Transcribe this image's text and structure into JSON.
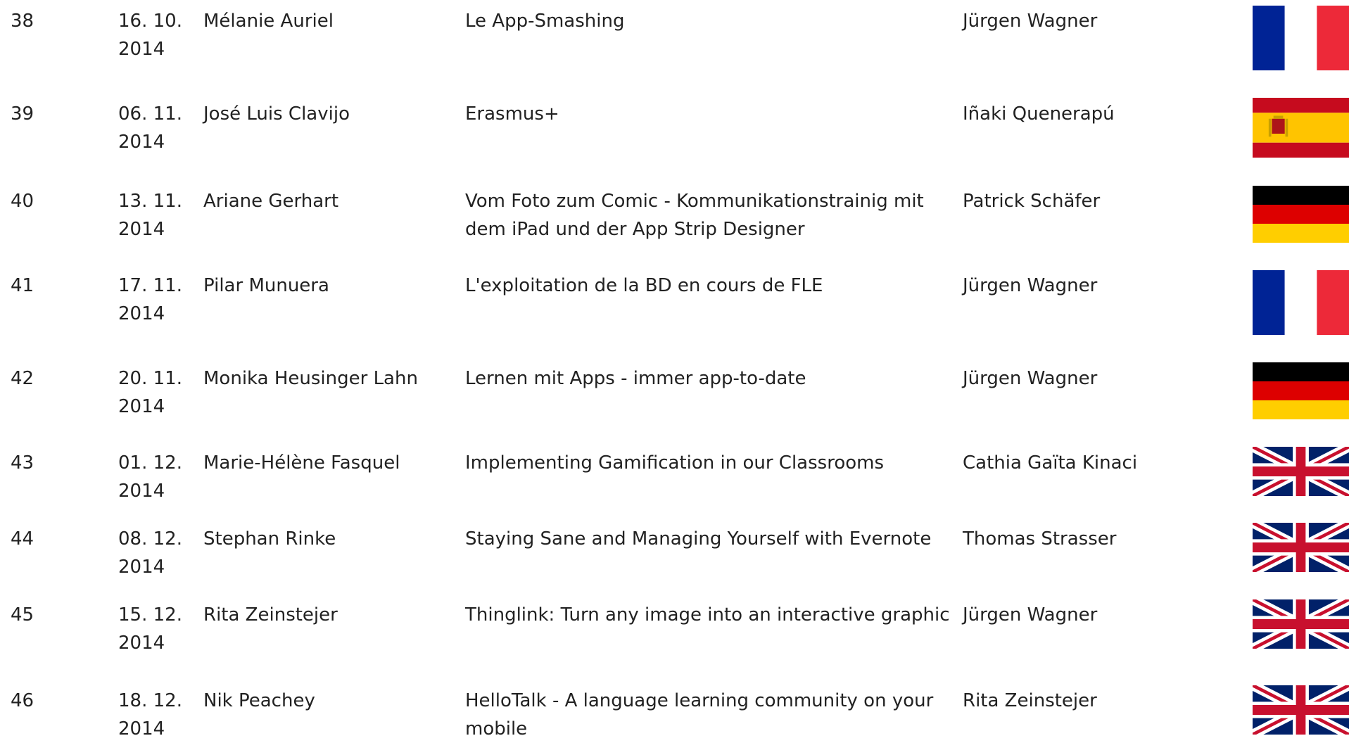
{
  "table": {
    "rows": [
      {
        "num": "38",
        "date_line1": "16. 10.",
        "date_line2": "2014",
        "speaker": "Mélanie Auriel",
        "topic": "Le App-Smashing",
        "host": "Jürgen Wagner",
        "flag": "flag-france-icon"
      },
      {
        "num": "39",
        "date_line1": "06. 11.",
        "date_line2": "2014",
        "speaker": "José Luis Clavijo",
        "topic": "Erasmus+",
        "host": "Iñaki Quenerapú",
        "flag": "flag-spain-icon"
      },
      {
        "num": "40",
        "date_line1": "13. 11.",
        "date_line2": "2014",
        "speaker": "Ariane Gerhart",
        "topic": "Vom Foto zum Comic - Kommunikationstrainig mit dem iPad und der App Strip Designer",
        "host": "Patrick Schäfer",
        "flag": "flag-germany-icon"
      },
      {
        "num": "41",
        "date_line1": "17. 11.",
        "date_line2": "2014",
        "speaker": "Pilar Munuera",
        "topic": "L'exploitation de la BD en cours de FLE",
        "host": "Jürgen Wagner",
        "flag": "flag-france-icon"
      },
      {
        "num": "42",
        "date_line1": "20. 11.",
        "date_line2": "2014",
        "speaker": "Monika Heusinger Lahn",
        "topic": "Lernen mit Apps - immer app-to-date",
        "host": "Jürgen Wagner",
        "flag": "flag-germany-icon"
      },
      {
        "num": "43",
        "date_line1": "01. 12.",
        "date_line2": "2014",
        "speaker": "Marie-Hélène Fasquel",
        "topic": "Implementing Gamification in our Classrooms",
        "host": "Cathia Gaïta Kinaci",
        "flag": "flag-uk-icon"
      },
      {
        "num": "44",
        "date_line1": "08. 12.",
        "date_line2": "2014",
        "speaker": "Stephan Rinke",
        "topic": "Staying Sane and Managing Yourself with Evernote",
        "host": "Thomas Strasser",
        "flag": "flag-uk-icon"
      },
      {
        "num": "45",
        "date_line1": "15. 12.",
        "date_line2": "2014",
        "speaker": "Rita Zeinstejer",
        "topic": "Thinglink: Turn any image into an interactive graphic",
        "host": "Jürgen Wagner",
        "flag": "flag-uk-icon"
      },
      {
        "num": "46",
        "date_line1": "18. 12.",
        "date_line2": "2014",
        "speaker": "Nik Peachey",
        "topic": "HelloTalk - A language learning community on your mobile",
        "host": "Rita Zeinstejer",
        "flag": "flag-uk-icon"
      }
    ]
  },
  "colors": {
    "text": "#222222",
    "france_blue": "#002395",
    "france_red": "#ED2939",
    "spain_red": "#C60B1E",
    "spain_yellow": "#FFC400",
    "germany_black": "#000000",
    "germany_red": "#DD0000",
    "germany_gold": "#FFCE00",
    "uk_blue": "#012169",
    "uk_red": "#C8102E"
  }
}
